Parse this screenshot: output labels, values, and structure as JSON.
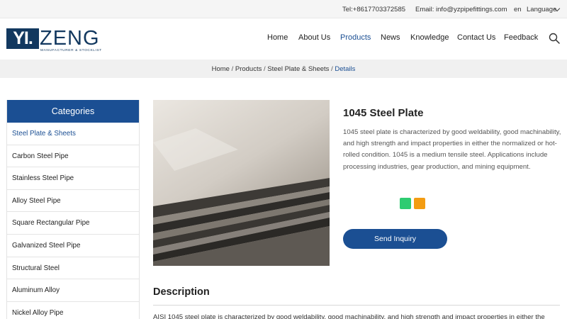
{
  "topbar": {
    "tel": "Tel:+8617703372585",
    "email": "Email: info@yzpipefittings.com",
    "lang_code": "en",
    "language_label": "Language"
  },
  "logo": {
    "mark": "YI.",
    "word": "ZENG",
    "tagline": "MANUFACTURER & STOCKLIST"
  },
  "nav": {
    "items": [
      {
        "label": "Home"
      },
      {
        "label": "About Us"
      },
      {
        "label": "Products",
        "active": true
      },
      {
        "label": "News"
      },
      {
        "label": "Knowledge"
      },
      {
        "label": "Contact Us"
      },
      {
        "label": "Feedback"
      }
    ],
    "search_icon": "search-icon"
  },
  "breadcrumb": {
    "items": [
      "Home",
      "Products",
      "Steel Plate & Sheets"
    ],
    "separator": "/",
    "current": "Details"
  },
  "sidebar": {
    "heading": "Categories",
    "items": [
      "Steel Plate & Sheets",
      "Carbon Steel Pipe",
      "Stainless Steel Pipe",
      "Alloy Steel Pipe",
      "Square Rectangular Pipe",
      "Galvanized Steel Pipe",
      "Structural Steel",
      "Aluminum Alloy",
      "Nickel Alloy Pipe"
    ],
    "active_index": 0
  },
  "product": {
    "title": "1045 Steel Plate",
    "description": "1045 steel plate is characterized by good weldability, good machinability, and high strength and impact properties in either the normalized or hot-rolled condition. 1045 is a medium tensile steel. Applications include processing industries, gear production, and mining equipment.",
    "inquiry_label": "Send Inquiry"
  },
  "colors": {
    "brand": "#1b4f93",
    "logo": "#12385f",
    "share_green": "#2ecc71",
    "share_orange": "#f39c12"
  },
  "description_section": {
    "heading": "Description",
    "body": "AISI 1045 steel plate is characterized by good weldability, good machinability, and high strength and impact properties in either the"
  }
}
